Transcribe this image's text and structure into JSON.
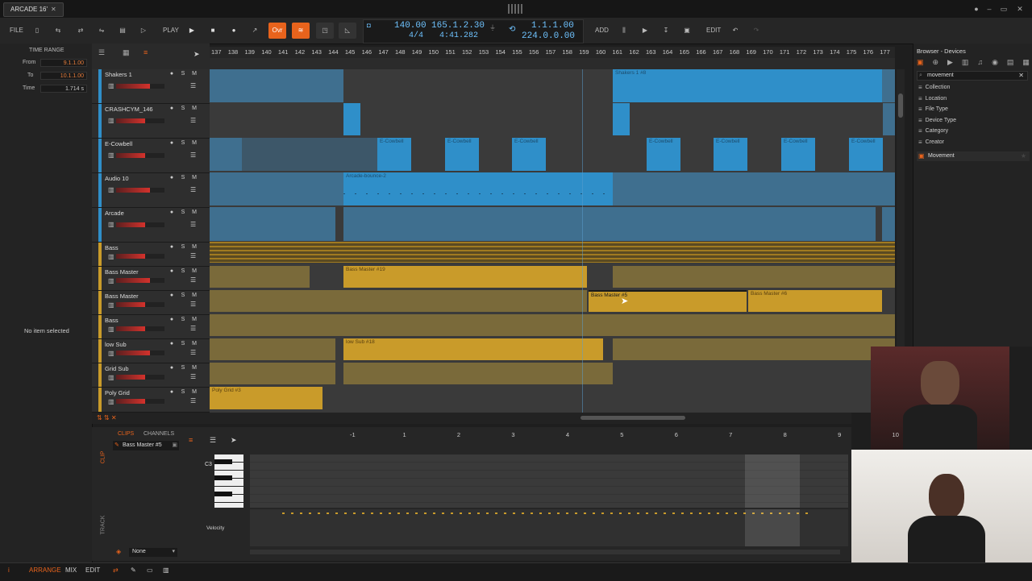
{
  "app": {
    "tab_title": "ARCADE 16'",
    "tab_close": "✕"
  },
  "toolbar": {
    "file": "FILE",
    "play_label": "PLAY",
    "ovr": "Ovr",
    "add": "ADD",
    "edit": "EDIT",
    "tempo": "140.00",
    "time_sig": "4/4",
    "position_bars": "165.1.2.30",
    "position_time": "4:41.282",
    "loop_start": "1.1.1.00",
    "loop_length": "224.0.0.00"
  },
  "inspector": {
    "time_range": "TIME RANGE",
    "from_label": "From",
    "from_val": "9.1.1.00",
    "to_label": "To",
    "to_val": "10.1.1.00",
    "time_label": "Time",
    "time_val": "1.714 s",
    "no_item": "No item selected"
  },
  "ruler": {
    "bars": [
      "137",
      "138",
      "139",
      "140",
      "141",
      "142",
      "143",
      "144",
      "145",
      "146",
      "147",
      "148",
      "149",
      "150",
      "151",
      "152",
      "153",
      "154",
      "155",
      "156",
      "157",
      "158",
      "159",
      "160",
      "161",
      "162",
      "163",
      "164",
      "165",
      "166",
      "167",
      "168",
      "169",
      "170",
      "171",
      "172",
      "173",
      "174",
      "175",
      "176",
      "177"
    ]
  },
  "tracks": [
    {
      "name": "Shakers 1",
      "color": "#2f8fc9"
    },
    {
      "name": "CRASHCYM_146",
      "color": "#2f8fc9"
    },
    {
      "name": "E-Cowbell",
      "color": "#2f8fc9"
    },
    {
      "name": "Audio 10",
      "color": "#2f8fc9"
    },
    {
      "name": "Arcade",
      "color": "#2f8fc9"
    },
    {
      "name": "Bass",
      "color": "#c99b2a"
    },
    {
      "name": "Bass Master",
      "color": "#c99b2a"
    },
    {
      "name": "Bass Master",
      "color": "#c99b2a"
    },
    {
      "name": "Bass",
      "color": "#c99b2a"
    },
    {
      "name": "low Sub",
      "color": "#c99b2a"
    },
    {
      "name": "Grid Sub",
      "color": "#c99b2a"
    },
    {
      "name": "Poly Grid",
      "color": "#c99b2a"
    }
  ],
  "track_buttons": {
    "s": "S",
    "m": "M"
  },
  "clips": {
    "shakers": "Shakers 1 #8",
    "audio_bounce": "Arcade-bounce-2",
    "bass_master_19": "Bass Master #19",
    "bass_master_5": "Bass Master #5",
    "bass_master_6": "Bass Master #6",
    "low_sub_18": "low Sub #18",
    "poly_grid_3": "Poly Grid #3",
    "cowbell": "E-Cowbell"
  },
  "browser": {
    "title": "Browser - Devices",
    "search": "movement",
    "filters": [
      "Collection",
      "Location",
      "File Type",
      "Device Type",
      "Category",
      "Creator"
    ],
    "result": "Movement"
  },
  "editor": {
    "tab_clips": "CLIPS",
    "tab_channels": "CHANNELS",
    "clip_name": "Bass Master #5",
    "side_clip": "CLIP",
    "side_track": "TRACK",
    "key_label": "C3",
    "velocity": "Velocity",
    "none": "None",
    "ruler": [
      "-1",
      "1",
      "2",
      "3",
      "4",
      "5",
      "6",
      "7",
      "8",
      "9",
      "10"
    ]
  },
  "bottombar": {
    "arrange": "ARRANGE",
    "mix": "MIX",
    "edit": "EDIT"
  },
  "colors": {
    "accent": "#e8631c",
    "blue_clip": "#2f8fc9",
    "gold_clip": "#c99b2a",
    "transport_text": "#6fc3ff"
  }
}
